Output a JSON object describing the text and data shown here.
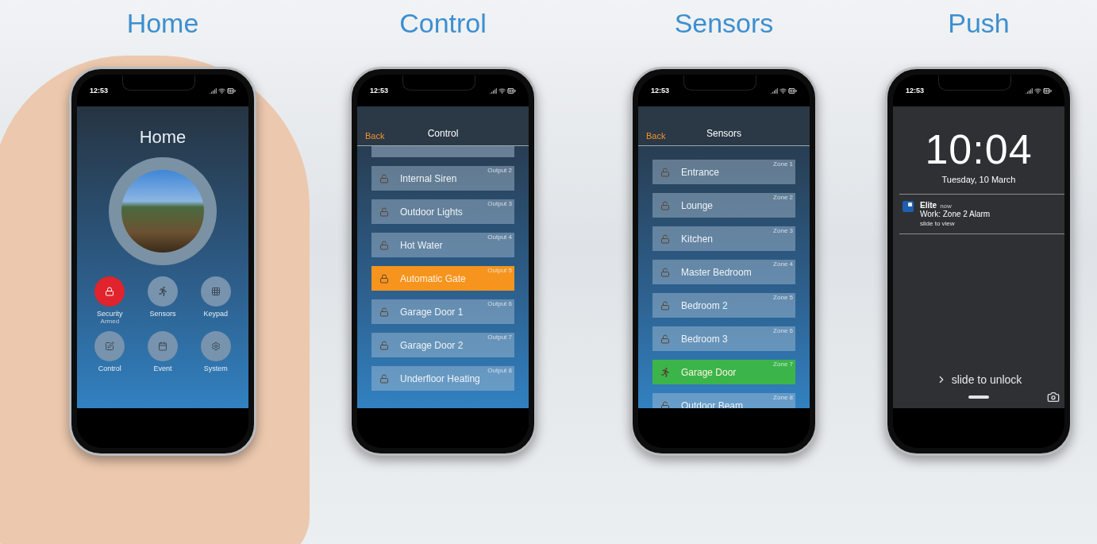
{
  "screens": [
    {
      "kind": "home",
      "caption": "Home",
      "status_time": "12:53",
      "title": "Home",
      "tiles": [
        {
          "label": "Security",
          "status": "Armed",
          "armed": true
        },
        {
          "label": "Sensors",
          "armed": false
        },
        {
          "label": "Keypad",
          "armed": false
        },
        {
          "label": "Control",
          "armed": false
        },
        {
          "label": "Event",
          "armed": false
        },
        {
          "label": "System",
          "armed": false
        }
      ]
    },
    {
      "kind": "control",
      "caption": "Control",
      "status_time": "12:53",
      "back": "Back",
      "title": "Control",
      "items": [
        {
          "name": "Internal Siren",
          "tag": "Output 2",
          "active": false
        },
        {
          "name": "Outdoor Lights",
          "tag": "Output 3",
          "active": false
        },
        {
          "name": "Hot Water",
          "tag": "Output 4",
          "active": false
        },
        {
          "name": "Automatic Gate",
          "tag": "Output 5",
          "active": true
        },
        {
          "name": "Garage Door 1",
          "tag": "Output 6",
          "active": false
        },
        {
          "name": "Garage Door 2",
          "tag": "Output 7",
          "active": false
        },
        {
          "name": "Underfloor Heating",
          "tag": "Output 8",
          "active": false
        }
      ]
    },
    {
      "kind": "sensors",
      "caption": "Sensors",
      "status_time": "12:53",
      "back": "Back",
      "title": "Sensors",
      "items": [
        {
          "name": "Entrance",
          "tag": "Zone 1",
          "active": false
        },
        {
          "name": "Lounge",
          "tag": "Zone 2",
          "active": false
        },
        {
          "name": "Kitchen",
          "tag": "Zone 3",
          "active": false
        },
        {
          "name": "Master Bedroom",
          "tag": "Zone 4",
          "active": false
        },
        {
          "name": "Bedroom 2",
          "tag": "Zone 5",
          "active": false
        },
        {
          "name": "Bedroom 3",
          "tag": "Zone 6",
          "active": false
        },
        {
          "name": "Garage Door",
          "tag": "Zone 7",
          "active": true
        },
        {
          "name": "Outdoor Beam",
          "tag": "Zone 8",
          "active": false
        }
      ]
    },
    {
      "kind": "lock",
      "caption": "Push",
      "status_time": "12:53",
      "clock": "10:04",
      "date": "Tuesday, 10 March",
      "notification": {
        "app": "Elite",
        "when": "now",
        "message": "Work: Zone 2 Alarm",
        "hint": "slide to view"
      },
      "unlock": "slide to unlock"
    }
  ]
}
